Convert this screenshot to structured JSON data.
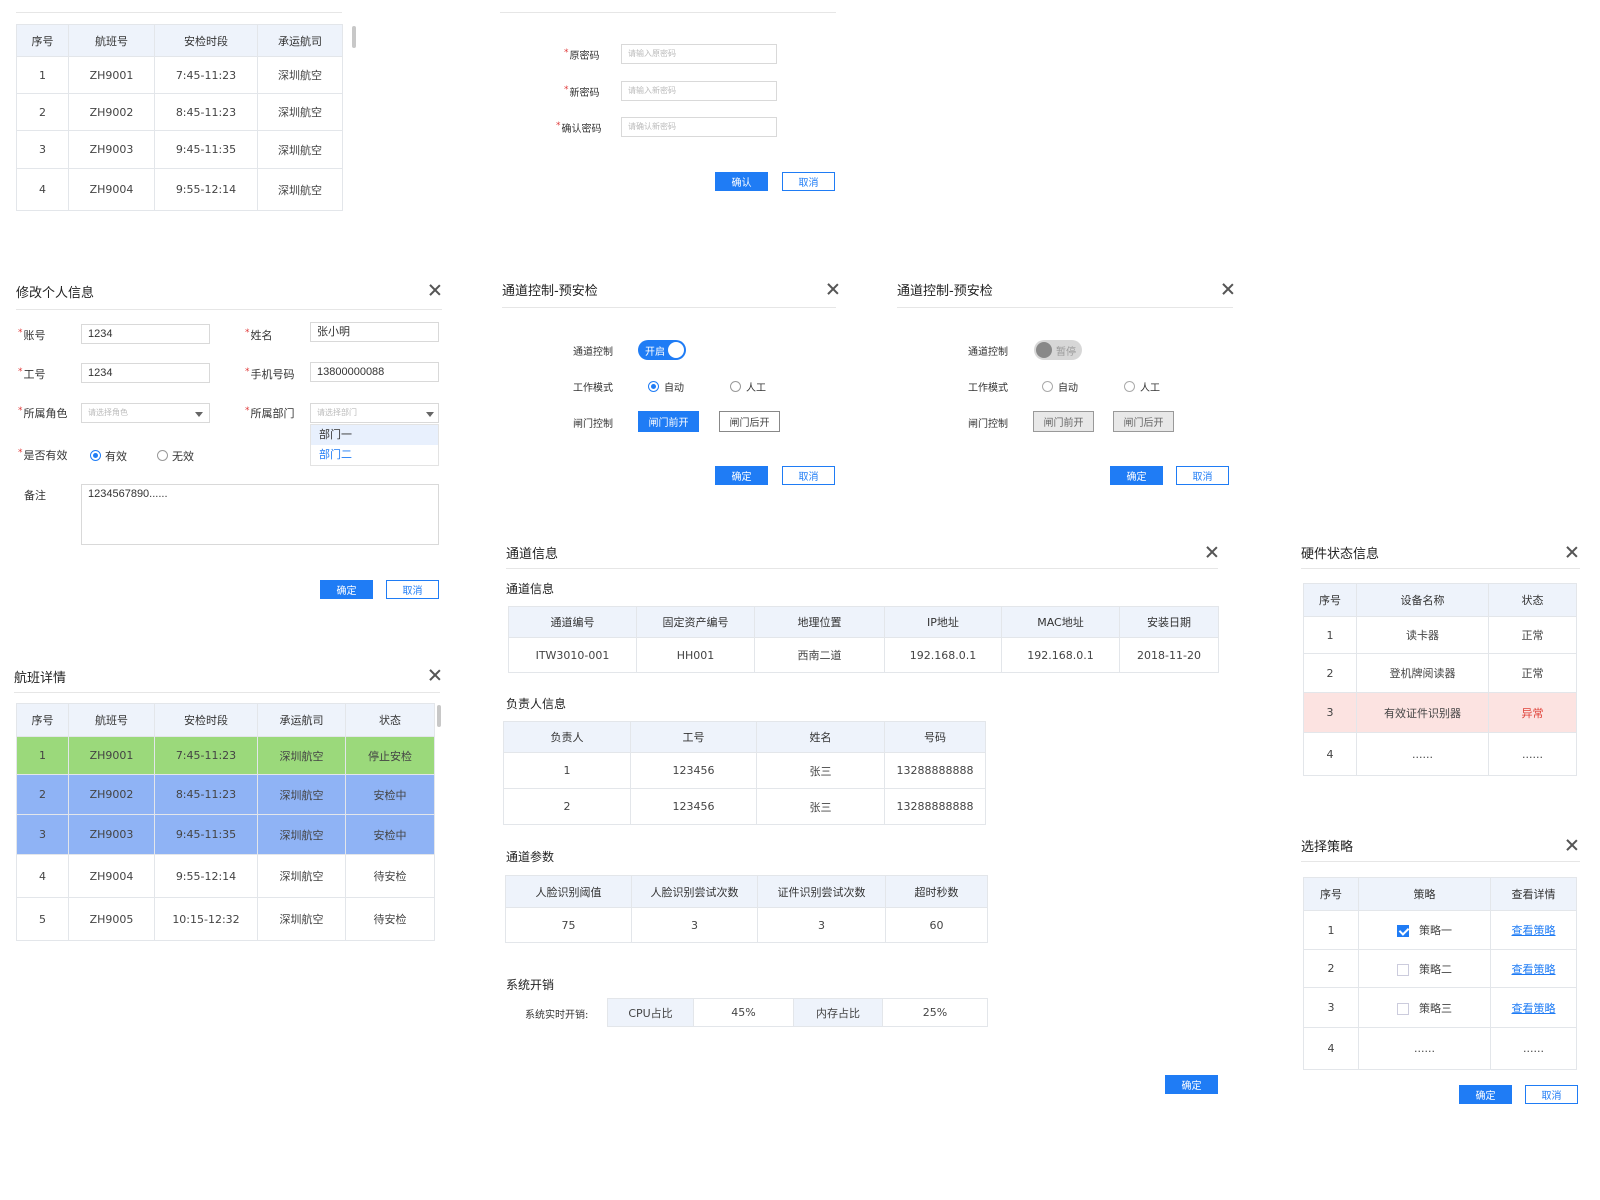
{
  "colors": {
    "primary": "#1f7cf5",
    "row_green": "#9bd97b",
    "row_blue": "#8fb3f5",
    "row_red": "#fce3e1",
    "danger": "#e0433a"
  },
  "flight_list": {
    "headers": [
      "序号",
      "航班号",
      "安检时段",
      "承运航司"
    ],
    "rows": [
      [
        "1",
        "ZH9001",
        "7:45-11:23",
        "深圳航空"
      ],
      [
        "2",
        "ZH9002",
        "8:45-11:23",
        "深圳航空"
      ],
      [
        "3",
        "ZH9003",
        "9:45-11:35",
        "深圳航空"
      ],
      [
        "4",
        "ZH9004",
        "9:55-12:14",
        "深圳航空"
      ]
    ]
  },
  "password": {
    "old_label": "原密码",
    "old_placeholder": "请输入原密码",
    "new_label": "新密码",
    "new_placeholder": "请输入新密码",
    "confirm_label": "确认密码",
    "confirm_placeholder": "请确认新密码",
    "ok": "确认",
    "cancel": "取消"
  },
  "profile": {
    "title": "修改个人信息",
    "account_label": "账号",
    "account_value": "1234",
    "name_label": "姓名",
    "name_value": "张小明",
    "job_label": "工号",
    "job_value": "1234",
    "phone_label": "手机号码",
    "phone_value": "13800000088",
    "role_label": "所属角色",
    "role_placeholder": "请选择角色",
    "dept_label": "所属部门",
    "dept_placeholder": "请选择部门",
    "dept_options": [
      "部门一",
      "部门二"
    ],
    "valid_label": "是否有效",
    "valid_yes": "有效",
    "valid_no": "无效",
    "note_label": "备注",
    "note_value": "1234567890......",
    "ok": "确定",
    "cancel": "取消"
  },
  "channel_on": {
    "title": "通道控制-预安检",
    "control_label": "通道控制",
    "toggle_text": "开启",
    "mode_label": "工作模式",
    "mode_auto": "自动",
    "mode_manual": "人工",
    "gate_label": "闸门控制",
    "gate_front": "闸门前开",
    "gate_back": "闸门后开",
    "ok": "确定",
    "cancel": "取消"
  },
  "channel_off": {
    "title": "通道控制-预安检",
    "control_label": "通道控制",
    "toggle_text": "暂停",
    "mode_label": "工作模式",
    "mode_auto": "自动",
    "mode_manual": "人工",
    "gate_label": "闸门控制",
    "gate_front": "闸门前开",
    "gate_back": "闸门后开",
    "ok": "确定",
    "cancel": "取消"
  },
  "flight_detail": {
    "title": "航班详情",
    "headers": [
      "序号",
      "航班号",
      "安检时段",
      "承运航司",
      "状态"
    ],
    "rows": [
      [
        "1",
        "ZH9001",
        "7:45-11:23",
        "深圳航空",
        "停止安检"
      ],
      [
        "2",
        "ZH9002",
        "8:45-11:23",
        "深圳航空",
        "安检中"
      ],
      [
        "3",
        "ZH9003",
        "9:45-11:35",
        "深圳航空",
        "安检中"
      ],
      [
        "4",
        "ZH9004",
        "9:55-12:14",
        "深圳航空",
        "待安检"
      ],
      [
        "5",
        "ZH9005",
        "10:15-12:32",
        "深圳航空",
        "待安检"
      ]
    ]
  },
  "channel_info": {
    "title": "通道信息",
    "sec1": "通道信息",
    "info_headers": [
      "通道编号",
      "固定资产编号",
      "地理位置",
      "IP地址",
      "MAC地址",
      "安装日期"
    ],
    "info_row": [
      "ITW3010-001",
      "HH001",
      "西南二道",
      "192.168.0.1",
      "192.168.0.1",
      "2018-11-20"
    ],
    "sec2": "负责人信息",
    "owner_headers": [
      "负责人",
      "工号",
      "姓名",
      "号码"
    ],
    "owner_rows": [
      [
        "1",
        "123456",
        "张三",
        "13288888888"
      ],
      [
        "2",
        "123456",
        "张三",
        "13288888888"
      ]
    ],
    "sec3": "通道参数",
    "param_headers": [
      "人脸识别阈值",
      "人脸识别尝试次数",
      "证件识别尝试次数",
      "超时秒数"
    ],
    "param_row": [
      "75",
      "3",
      "3",
      "60"
    ],
    "sec4": "系统开销",
    "overhead_label": "系统实时开销:",
    "overhead_cells": [
      "CPU占比",
      "45%",
      "内存占比",
      "25%"
    ],
    "ok": "确定"
  },
  "hardware": {
    "title": "硬件状态信息",
    "headers": [
      "序号",
      "设备名称",
      "状态"
    ],
    "rows": [
      [
        "1",
        "读卡器",
        "正常"
      ],
      [
        "2",
        "登机牌阅读器",
        "正常"
      ],
      [
        "3",
        "有效证件识别器",
        "异常"
      ],
      [
        "4",
        "......",
        "......"
      ]
    ]
  },
  "strategy": {
    "title": "选择策略",
    "headers": [
      "序号",
      "策略",
      "查看详情"
    ],
    "rows": [
      [
        "1",
        "策略一",
        "查看策略"
      ],
      [
        "2",
        "策略二",
        "查看策略"
      ],
      [
        "3",
        "策略三",
        "查看策略"
      ],
      [
        "4",
        "......",
        "......"
      ]
    ],
    "ok": "确定",
    "cancel": "取消"
  }
}
